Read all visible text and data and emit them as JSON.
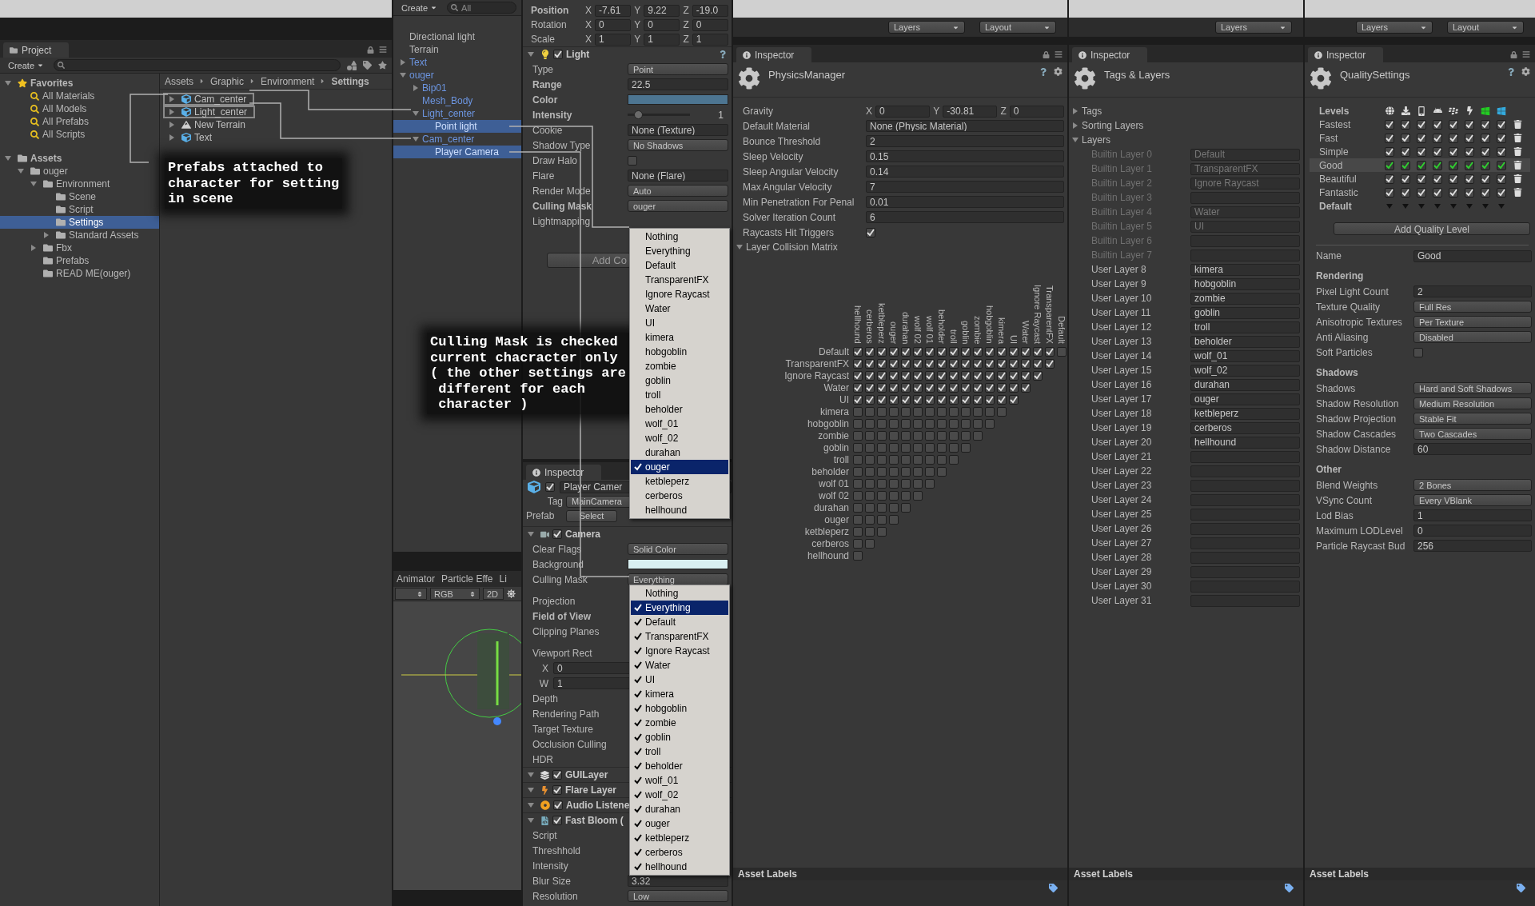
{
  "project": {
    "tab": "Project",
    "create": "Create",
    "tree": [
      {
        "label": "Favorites",
        "kind": "favorites",
        "expanded": true,
        "selected": false,
        "children": [
          {
            "label": "All Materials",
            "kind": "search",
            "selected": false
          },
          {
            "label": "All Models",
            "kind": "search",
            "selected": false
          },
          {
            "label": "All Prefabs",
            "kind": "search",
            "selected": false
          },
          {
            "label": "All Scripts",
            "kind": "search",
            "selected": false
          }
        ]
      },
      {
        "label": "Assets",
        "kind": "folder",
        "expanded": true,
        "selected": false,
        "children": [
          {
            "label": "ouger",
            "kind": "folder",
            "expanded": true,
            "selected": false,
            "children": [
              {
                "label": "Environment",
                "kind": "folder",
                "expanded": true,
                "selected": false,
                "children": [
                  {
                    "label": "Scene",
                    "kind": "folder",
                    "selected": false
                  },
                  {
                    "label": "Script",
                    "kind": "folder",
                    "selected": false
                  },
                  {
                    "label": "Settings",
                    "kind": "folder",
                    "selected": true
                  },
                  {
                    "label": "Standard Assets",
                    "kind": "folder",
                    "expanded": false,
                    "selected": false
                  }
                ]
              },
              {
                "label": "Fbx",
                "kind": "folder",
                "expanded": false,
                "selected": false
              },
              {
                "label": "Prefabs",
                "kind": "folder",
                "selected": false
              },
              {
                "label": "READ ME(ouger)",
                "kind": "folder",
                "selected": false
              }
            ]
          }
        ]
      }
    ],
    "breadcrumb": [
      {
        "label": "Assets",
        "current": false
      },
      {
        "label": "Graphic",
        "current": false
      },
      {
        "label": "Environment",
        "current": false
      },
      {
        "label": "Settings",
        "current": true
      }
    ],
    "files": [
      {
        "label": "Cam_center",
        "kind": "prefab",
        "outlined": true
      },
      {
        "label": "Light_center",
        "kind": "prefab",
        "outlined": true
      },
      {
        "label": "New Terrain",
        "kind": "terrain",
        "outlined": false
      },
      {
        "label": "Text",
        "kind": "prefab",
        "outlined": false
      }
    ],
    "callout": "Prefabs attached to\ncharacter for setting\nin scene"
  },
  "hierarchy": {
    "create": "Create",
    "search_placeholder": "All",
    "items": [
      {
        "label": "Directional light",
        "prefab": false,
        "selected": false
      },
      {
        "label": "Terrain",
        "prefab": false,
        "selected": false
      },
      {
        "label": "Text",
        "expanded": false,
        "prefab": true,
        "selected": false
      },
      {
        "label": "ouger",
        "expanded": true,
        "prefab": true,
        "selected": false,
        "children": [
          {
            "label": "Bip01",
            "expanded": false,
            "prefab": true,
            "selected": false
          },
          {
            "label": "Mesh_Body",
            "prefab": true,
            "selected": false
          },
          {
            "label": "Light_center",
            "expanded": true,
            "prefab": true,
            "selected": false,
            "children": [
              {
                "label": "Point light",
                "prefab": true,
                "selected": true
              }
            ]
          },
          {
            "label": "Cam_center",
            "expanded": true,
            "prefab": true,
            "selected": false,
            "children": [
              {
                "label": "Player Camera",
                "prefab": true,
                "selected": true
              }
            ]
          }
        ]
      }
    ]
  },
  "scene": {
    "tabs": [
      "Animator",
      "Particle Effe",
      "Li"
    ],
    "toolbar": [
      "RGB",
      "2D"
    ]
  },
  "light_inspector": {
    "transform": [
      {
        "label": "Position",
        "bold": true,
        "values": [
          {
            "axis": "X",
            "value": "-7.61"
          },
          {
            "axis": "Y",
            "value": "9.22"
          },
          {
            "axis": "Z",
            "value": "-19.0"
          }
        ]
      },
      {
        "label": "Rotation",
        "bold": false,
        "values": [
          {
            "axis": "X",
            "value": "0"
          },
          {
            "axis": "Y",
            "value": "0"
          },
          {
            "axis": "Z",
            "value": "0"
          }
        ]
      },
      {
        "label": "Scale",
        "bold": false,
        "values": [
          {
            "axis": "X",
            "value": "1"
          },
          {
            "axis": "Y",
            "value": "1"
          },
          {
            "axis": "Z",
            "value": "1"
          }
        ]
      }
    ],
    "component": {
      "label": "Light",
      "enabled": true
    },
    "rows": [
      {
        "label": "Type",
        "bold": false,
        "kind": "dropdown",
        "value": "Point"
      },
      {
        "label": "Range",
        "bold": true,
        "kind": "field",
        "value": "22.5"
      },
      {
        "label": "Color",
        "bold": true,
        "kind": "color",
        "color": "#4d7591"
      },
      {
        "label": "Intensity",
        "bold": true,
        "kind": "slider",
        "level": 0.125,
        "value": "1"
      },
      {
        "label": "Cookie",
        "bold": false,
        "kind": "field",
        "value": "None (Texture)"
      },
      {
        "label": "Shadow Type",
        "bold": false,
        "kind": "dropdown",
        "value": "No Shadows"
      },
      {
        "label": "Draw Halo",
        "bold": false,
        "kind": "checkbox",
        "checked": false
      },
      {
        "label": "Flare",
        "bold": false,
        "kind": "field",
        "value": "None (Flare)"
      },
      {
        "label": "Render Mode",
        "bold": false,
        "kind": "dropdown",
        "value": "Auto"
      },
      {
        "label": "Culling Mask",
        "bold": true,
        "kind": "dropdown",
        "value": "ouger"
      },
      {
        "label": "Lightmapping",
        "bold": false,
        "kind": "blank"
      }
    ],
    "add_button": "Add Co",
    "callout": "Culling Mask is checked\ncurrent chacracter only\n( the other settings are\n different for each\n character )"
  },
  "light_menu": {
    "options": [
      {
        "label": "Nothing",
        "checked": false,
        "selected": false
      },
      {
        "label": "Everything",
        "checked": false,
        "selected": false
      },
      {
        "label": "Default",
        "checked": false,
        "selected": false
      },
      {
        "label": "TransparentFX",
        "checked": false,
        "selected": false
      },
      {
        "label": "Ignore Raycast",
        "checked": false,
        "selected": false
      },
      {
        "label": "Water",
        "checked": false,
        "selected": false
      },
      {
        "label": "UI",
        "checked": false,
        "selected": false
      },
      {
        "label": "kimera",
        "checked": false,
        "selected": false
      },
      {
        "label": "hobgoblin",
        "checked": false,
        "selected": false
      },
      {
        "label": "zombie",
        "checked": false,
        "selected": false
      },
      {
        "label": "goblin",
        "checked": false,
        "selected": false
      },
      {
        "label": "troll",
        "checked": false,
        "selected": false
      },
      {
        "label": "beholder",
        "checked": false,
        "selected": false
      },
      {
        "label": "wolf_01",
        "checked": false,
        "selected": false
      },
      {
        "label": "wolf_02",
        "checked": false,
        "selected": false
      },
      {
        "label": "durahan",
        "checked": false,
        "selected": false
      },
      {
        "label": "ouger",
        "checked": true,
        "selected": true
      },
      {
        "label": "ketbleperz",
        "checked": false,
        "selected": false
      },
      {
        "label": "cerberos",
        "checked": false,
        "selected": false
      },
      {
        "label": "hellhound",
        "checked": false,
        "selected": false
      }
    ]
  },
  "camera_inspector": {
    "tab": "Inspector",
    "object": {
      "name": "Player Camer",
      "enabled": true,
      "tag_label": "Tag",
      "tag": "MainCamera",
      "prefab_label": "Prefab",
      "prefab_button": "Select"
    },
    "components": [
      {
        "label": "Camera",
        "enabled": true,
        "rows": [
          {
            "label": "Clear Flags",
            "bold": false,
            "kind": "dropdown",
            "value": "Solid Color"
          },
          {
            "label": "Background",
            "bold": false,
            "kind": "color",
            "color": "#d9f0f2"
          },
          {
            "label": "Culling Mask",
            "bold": false,
            "kind": "dropdown",
            "value": "Everything"
          },
          {
            "label": "Projection",
            "bold": false,
            "kind": "blank"
          },
          {
            "label": "Field of View",
            "bold": true,
            "kind": "blank"
          },
          {
            "label": "Clipping Planes",
            "bold": false,
            "kind": "blank"
          },
          {
            "label": "Viewport Rect",
            "bold": false,
            "kind": "blank"
          },
          {
            "label": "X",
            "bold": false,
            "kind": "sub",
            "value": "0"
          },
          {
            "label": "W",
            "bold": false,
            "kind": "sub",
            "value": "1"
          },
          {
            "label": "Depth",
            "bold": false,
            "kind": "blank"
          },
          {
            "label": "Rendering Path",
            "bold": false,
            "kind": "blank"
          },
          {
            "label": "Target Texture",
            "bold": false,
            "kind": "blank"
          },
          {
            "label": "Occlusion Culling",
            "bold": false,
            "kind": "blank"
          },
          {
            "label": "HDR",
            "bold": false,
            "kind": "blank"
          }
        ]
      },
      {
        "label": "GUILayer",
        "enabled": true
      },
      {
        "label": "Flare Layer",
        "enabled": true
      },
      {
        "label": "Audio Listene",
        "enabled": true
      },
      {
        "label": "Fast Bloom (",
        "enabled": true,
        "rows": [
          {
            "label": "Script",
            "bold": false,
            "kind": "blank"
          },
          {
            "label": "Threshhold",
            "bold": false,
            "kind": "blank"
          },
          {
            "label": "Intensity",
            "bold": false,
            "kind": "blank"
          },
          {
            "label": "Blur Size",
            "bold": false,
            "kind": "field",
            "value": "3.32"
          },
          {
            "label": "Resolution",
            "bold": false,
            "kind": "dropdown",
            "value": "Low"
          }
        ]
      }
    ]
  },
  "camera_menu": {
    "options": [
      {
        "label": "Nothing",
        "checked": false,
        "selected": false
      },
      {
        "label": "Everything",
        "checked": true,
        "selected": true
      },
      {
        "label": "Default",
        "checked": true,
        "selected": false
      },
      {
        "label": "TransparentFX",
        "checked": true,
        "selected": false
      },
      {
        "label": "Ignore Raycast",
        "checked": true,
        "selected": false
      },
      {
        "label": "Water",
        "checked": true,
        "selected": false
      },
      {
        "label": "UI",
        "checked": true,
        "selected": false
      },
      {
        "label": "kimera",
        "checked": true,
        "selected": false
      },
      {
        "label": "hobgoblin",
        "checked": true,
        "selected": false
      },
      {
        "label": "zombie",
        "checked": true,
        "selected": false
      },
      {
        "label": "goblin",
        "checked": true,
        "selected": false
      },
      {
        "label": "troll",
        "checked": true,
        "selected": false
      },
      {
        "label": "beholder",
        "checked": true,
        "selected": false
      },
      {
        "label": "wolf_01",
        "checked": true,
        "selected": false
      },
      {
        "label": "wolf_02",
        "checked": true,
        "selected": false
      },
      {
        "label": "durahan",
        "checked": true,
        "selected": false
      },
      {
        "label": "ouger",
        "checked": true,
        "selected": false
      },
      {
        "label": "ketbleperz",
        "checked": true,
        "selected": false
      },
      {
        "label": "cerberos",
        "checked": true,
        "selected": false
      },
      {
        "label": "hellhound",
        "checked": true,
        "selected": false
      }
    ]
  },
  "physics": {
    "toolbar": [
      "Layers",
      "Layout"
    ],
    "tab": "Inspector",
    "title": "PhysicsManager",
    "gravity": {
      "label": "Gravity",
      "values": [
        {
          "axis": "X",
          "value": "0"
        },
        {
          "axis": "Y",
          "value": "-30.81"
        },
        {
          "axis": "Z",
          "value": "0"
        }
      ]
    },
    "rows": [
      {
        "label": "Default Material",
        "kind": "object",
        "value": "None (Physic Material)"
      },
      {
        "label": "Bounce Threshold",
        "kind": "field",
        "value": "2"
      },
      {
        "label": "Sleep Velocity",
        "kind": "field",
        "value": "0.15"
      },
      {
        "label": "Sleep Angular Velocity",
        "kind": "field",
        "value": "0.14"
      },
      {
        "label": "Max Angular Velocity",
        "kind": "field",
        "value": "7"
      },
      {
        "label": "Min Penetration For Penal",
        "kind": "field",
        "value": "0.01"
      },
      {
        "label": "Solver Iteration Count",
        "kind": "field",
        "value": "6"
      },
      {
        "label": "Raycasts Hit Triggers",
        "kind": "checkbox",
        "checked": true
      }
    ],
    "matrix": {
      "label": "Layer Collision Matrix",
      "expanded": true,
      "columns": [
        "hellhound",
        "cerberos",
        "ketbleperz",
        "ouger",
        "durahan",
        "wolf 02",
        "wolf 01",
        "beholder",
        "troll",
        "goblin",
        "zombie",
        "hobgoblin",
        "kimera",
        "UI",
        "Water",
        "Ignore Raycast",
        "TransparentFX",
        "Default"
      ],
      "rows": [
        {
          "label": "Default",
          "cells": [
            true,
            true,
            true,
            true,
            true,
            true,
            true,
            true,
            true,
            true,
            true,
            true,
            true,
            true,
            true,
            true,
            true,
            false
          ]
        },
        {
          "label": "TransparentFX",
          "cells": [
            true,
            true,
            true,
            true,
            true,
            true,
            true,
            true,
            true,
            true,
            true,
            true,
            true,
            true,
            true,
            true,
            true
          ]
        },
        {
          "label": "Ignore Raycast",
          "cells": [
            true,
            true,
            true,
            true,
            true,
            true,
            true,
            true,
            true,
            true,
            true,
            true,
            true,
            true,
            true,
            true
          ]
        },
        {
          "label": "Water",
          "cells": [
            true,
            true,
            true,
            true,
            true,
            true,
            true,
            true,
            true,
            true,
            true,
            true,
            true,
            true,
            true
          ]
        },
        {
          "label": "UI",
          "cells": [
            true,
            true,
            true,
            true,
            true,
            true,
            true,
            true,
            true,
            true,
            true,
            true,
            true,
            true
          ]
        },
        {
          "label": "kimera",
          "cells": [
            false,
            false,
            false,
            false,
            false,
            false,
            false,
            false,
            false,
            false,
            false,
            false,
            false
          ]
        },
        {
          "label": "hobgoblin",
          "cells": [
            false,
            false,
            false,
            false,
            false,
            false,
            false,
            false,
            false,
            false,
            false,
            false
          ]
        },
        {
          "label": "zombie",
          "cells": [
            false,
            false,
            false,
            false,
            false,
            false,
            false,
            false,
            false,
            false,
            false
          ]
        },
        {
          "label": "goblin",
          "cells": [
            false,
            false,
            false,
            false,
            false,
            false,
            false,
            false,
            false,
            false
          ]
        },
        {
          "label": "troll",
          "cells": [
            false,
            false,
            false,
            false,
            false,
            false,
            false,
            false,
            false
          ]
        },
        {
          "label": "beholder",
          "cells": [
            false,
            false,
            false,
            false,
            false,
            false,
            false,
            false
          ]
        },
        {
          "label": "wolf 01",
          "cells": [
            false,
            false,
            false,
            false,
            false,
            false,
            false
          ]
        },
        {
          "label": "wolf 02",
          "cells": [
            false,
            false,
            false,
            false,
            false,
            false
          ]
        },
        {
          "label": "durahan",
          "cells": [
            false,
            false,
            false,
            false,
            false
          ]
        },
        {
          "label": "ouger",
          "cells": [
            false,
            false,
            false,
            false
          ]
        },
        {
          "label": "ketbleperz",
          "cells": [
            false,
            false,
            false
          ]
        },
        {
          "label": "cerberos",
          "cells": [
            false,
            false
          ]
        },
        {
          "label": "hellhound",
          "cells": [
            false
          ]
        }
      ]
    },
    "footer": "Asset Labels"
  },
  "tags_layers": {
    "toolbar": [
      "Layers"
    ],
    "tab": "Inspector",
    "title": "Tags & Layers",
    "sections": [
      {
        "label": "Tags",
        "expanded": false
      },
      {
        "label": "Sorting Layers",
        "expanded": false
      },
      {
        "label": "Layers",
        "expanded": true
      }
    ],
    "layers": [
      {
        "label": "Builtin Layer 0",
        "value": "Default",
        "disabled": true
      },
      {
        "label": "Builtin Layer 1",
        "value": "TransparentFX",
        "disabled": true
      },
      {
        "label": "Builtin Layer 2",
        "value": "Ignore Raycast",
        "disabled": true
      },
      {
        "label": "Builtin Layer 3",
        "disabled": true
      },
      {
        "label": "Builtin Layer 4",
        "value": "Water",
        "disabled": true
      },
      {
        "label": "Builtin Layer 5",
        "value": "UI",
        "disabled": true
      },
      {
        "label": "Builtin Layer 6",
        "disabled": true
      },
      {
        "label": "Builtin Layer 7",
        "disabled": true
      },
      {
        "label": "User Layer 8",
        "value": "kimera",
        "disabled": false
      },
      {
        "label": "User Layer 9",
        "value": "hobgoblin",
        "disabled": false
      },
      {
        "label": "User Layer 10",
        "value": "zombie",
        "disabled": false
      },
      {
        "label": "User Layer 11",
        "value": "goblin",
        "disabled": false
      },
      {
        "label": "User Layer 12",
        "value": "troll",
        "disabled": false
      },
      {
        "label": "User Layer 13",
        "value": "beholder",
        "disabled": false
      },
      {
        "label": "User Layer 14",
        "value": "wolf_01",
        "disabled": false
      },
      {
        "label": "User Layer 15",
        "value": "wolf_02",
        "disabled": false
      },
      {
        "label": "User Layer 16",
        "value": "durahan",
        "disabled": false
      },
      {
        "label": "User Layer 17",
        "value": "ouger",
        "disabled": false
      },
      {
        "label": "User Layer 18",
        "value": "ketbleperz",
        "disabled": false
      },
      {
        "label": "User Layer 19",
        "value": "cerberos",
        "disabled": false
      },
      {
        "label": "User Layer 20",
        "value": "hellhound",
        "disabled": false
      },
      {
        "label": "User Layer 21",
        "disabled": false
      },
      {
        "label": "User Layer 22",
        "disabled": false
      },
      {
        "label": "User Layer 23",
        "disabled": false
      },
      {
        "label": "User Layer 24",
        "disabled": false
      },
      {
        "label": "User Layer 25",
        "disabled": false
      },
      {
        "label": "User Layer 26",
        "disabled": false
      },
      {
        "label": "User Layer 27",
        "disabled": false
      },
      {
        "label": "User Layer 28",
        "disabled": false
      },
      {
        "label": "User Layer 29",
        "disabled": false
      },
      {
        "label": "User Layer 30",
        "disabled": false
      },
      {
        "label": "User Layer 31",
        "disabled": false
      }
    ],
    "footer": "Asset Labels"
  },
  "quality": {
    "toolbar": [
      "Layers",
      "Layout"
    ],
    "tab": "Inspector",
    "title": "QualitySettings",
    "levels_label": "Levels",
    "levels": [
      {
        "label": "Fastest",
        "selected": false,
        "checks": [
          true,
          true,
          true,
          true,
          true,
          true,
          true,
          true
        ]
      },
      {
        "label": "Fast",
        "selected": false,
        "checks": [
          true,
          true,
          true,
          true,
          true,
          true,
          true,
          true
        ]
      },
      {
        "label": "Simple",
        "selected": false,
        "checks": [
          true,
          true,
          true,
          true,
          true,
          true,
          true,
          true
        ]
      },
      {
        "label": "Good",
        "selected": true,
        "checks": [
          true,
          true,
          true,
          true,
          true,
          true,
          true,
          true
        ]
      },
      {
        "label": "Beautiful",
        "selected": false,
        "checks": [
          true,
          true,
          true,
          true,
          true,
          true,
          true,
          true
        ]
      },
      {
        "label": "Fantastic",
        "selected": false,
        "checks": [
          true,
          true,
          true,
          true,
          true,
          true,
          true,
          true
        ]
      }
    ],
    "default_label": "Default",
    "add_button": "Add Quality Level",
    "name": {
      "label": "Name",
      "value": "Good"
    },
    "sections": [
      {
        "title": "Rendering",
        "rows": [
          {
            "label": "Pixel Light Count",
            "kind": "field",
            "value": "2"
          },
          {
            "label": "Texture Quality",
            "kind": "dropdown",
            "value": "Full Res"
          },
          {
            "label": "Anisotropic Textures",
            "kind": "dropdown",
            "value": "Per Texture"
          },
          {
            "label": "Anti Aliasing",
            "kind": "dropdown",
            "value": "Disabled"
          },
          {
            "label": "Soft Particles",
            "kind": "checkbox",
            "checked": false
          }
        ]
      },
      {
        "title": "Shadows",
        "rows": [
          {
            "label": "Shadows",
            "kind": "dropdown",
            "value": "Hard and Soft Shadows"
          },
          {
            "label": "Shadow Resolution",
            "kind": "dropdown",
            "value": "Medium Resolution"
          },
          {
            "label": "Shadow Projection",
            "kind": "dropdown",
            "value": "Stable Fit"
          },
          {
            "label": "Shadow Cascades",
            "kind": "dropdown",
            "value": "Two Cascades"
          },
          {
            "label": "Shadow Distance",
            "kind": "field",
            "value": "60"
          }
        ]
      },
      {
        "title": "Other",
        "rows": [
          {
            "label": "Blend Weights",
            "kind": "dropdown",
            "value": "2 Bones"
          },
          {
            "label": "VSync Count",
            "kind": "dropdown",
            "value": "Every VBlank"
          },
          {
            "label": "Lod Bias",
            "kind": "field",
            "value": "1"
          },
          {
            "label": "Maximum LODLevel",
            "kind": "field",
            "value": "0"
          },
          {
            "label": "Particle Raycast Bud",
            "kind": "field",
            "value": "256"
          }
        ]
      }
    ],
    "footer": "Asset Labels"
  }
}
